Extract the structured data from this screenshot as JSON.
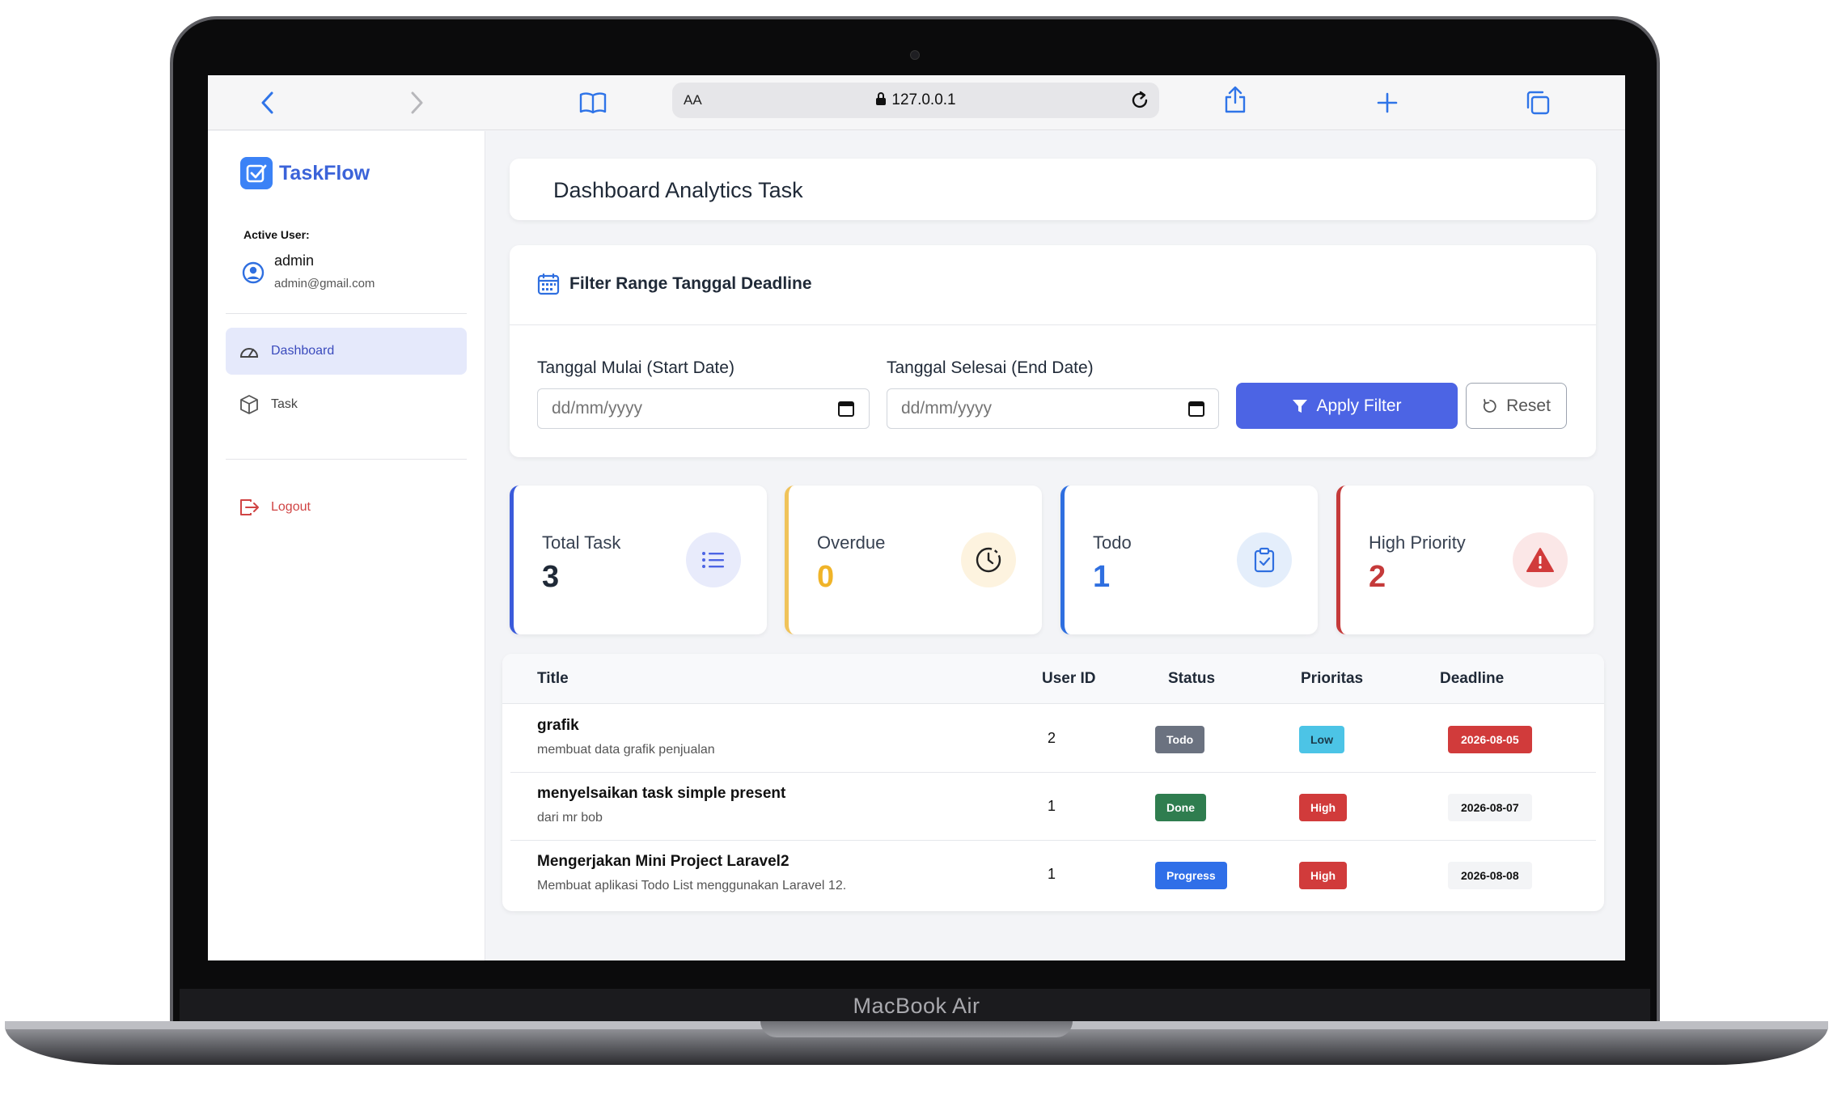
{
  "device": {
    "brand": "MacBook Air"
  },
  "browser": {
    "aa": "AA",
    "url": "127.0.0.1"
  },
  "app": {
    "name": "TaskFlow"
  },
  "user": {
    "active_label": "Active User:",
    "name": "admin",
    "email": "admin@gmail.com"
  },
  "nav": {
    "dashboard": "Dashboard",
    "task": "Task",
    "logout": "Logout"
  },
  "page": {
    "title": "Dashboard Analytics Task"
  },
  "filter": {
    "heading": "Filter Range Tanggal Deadline",
    "start_label": "Tanggal Mulai (Start Date)",
    "end_label": "Tanggal Selesai (End Date)",
    "start_placeholder": "dd/mm/yyyy",
    "end_placeholder": "dd/mm/yyyy",
    "apply": "Apply Filter",
    "reset": "Reset"
  },
  "stats": {
    "total": {
      "label": "Total Task",
      "value": "3",
      "color": "#3b5bdb"
    },
    "overdue": {
      "label": "Overdue",
      "value": "0",
      "color": "#f0b429"
    },
    "todo": {
      "label": "Todo",
      "value": "1",
      "color": "#2f6fe0"
    },
    "high": {
      "label": "High Priority",
      "value": "2",
      "color": "#c53a3a"
    }
  },
  "table": {
    "headers": {
      "title": "Title",
      "user_id": "User ID",
      "status": "Status",
      "prioritas": "Prioritas",
      "deadline": "Deadline"
    },
    "rows": [
      {
        "title": "grafik",
        "desc": "membuat data grafik penjualan",
        "user_id": "2",
        "status": "Todo",
        "priority": "Low",
        "deadline": "2026-08-05"
      },
      {
        "title": "menyelsaikan task simple present",
        "desc": "dari mr bob",
        "user_id": "1",
        "status": "Done",
        "priority": "High",
        "deadline": "2026-08-07"
      },
      {
        "title": "Mengerjakan Mini Project Laravel2",
        "desc": "Membuat aplikasi Todo List menggunakan Laravel 12.",
        "user_id": "1",
        "status": "Progress",
        "priority": "High",
        "deadline": "2026-08-08"
      }
    ]
  },
  "colors": {
    "status_todo": "#6b7280",
    "status_done": "#2f7d4f",
    "status_progress": "#2f6fe8",
    "priority_low": "#4cc4e6",
    "priority_high": "#d13b3b",
    "deadline_overdue": "#d13b3b",
    "deadline_normal": "#f3f4f6"
  }
}
